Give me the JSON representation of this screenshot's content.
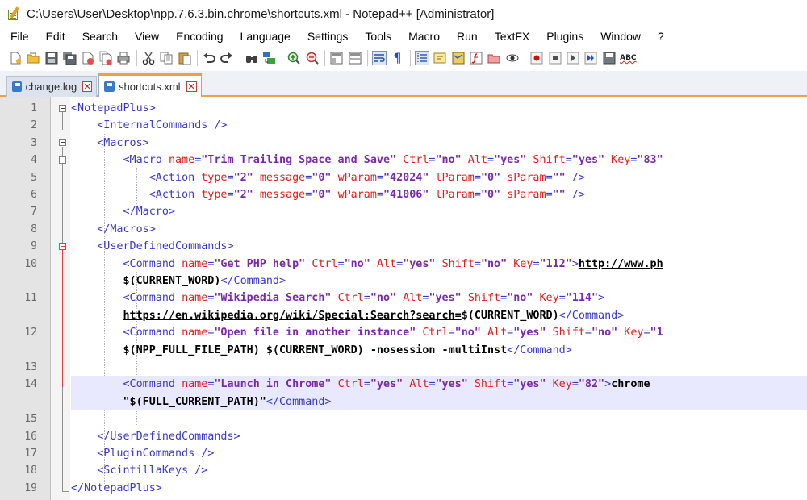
{
  "window": {
    "title": "C:\\Users\\User\\Desktop\\npp.7.6.3.bin.chrome\\shortcuts.xml - Notepad++ [Administrator]"
  },
  "menu": [
    "File",
    "Edit",
    "Search",
    "View",
    "Encoding",
    "Language",
    "Settings",
    "Tools",
    "Macro",
    "Run",
    "TextFX",
    "Plugins",
    "Window",
    "?"
  ],
  "toolbar": {
    "buttons": [
      "new-file-icon",
      "open-file-icon",
      "save-icon",
      "save-all-icon",
      "close-icon",
      "close-all-icon",
      "print-icon",
      "cut-icon",
      "copy-icon",
      "paste-icon",
      "undo-icon",
      "redo-icon",
      "find-icon",
      "replace-icon",
      "zoom-in-icon",
      "zoom-out-icon",
      "sync-vertical-icon",
      "sync-horizontal-icon",
      "word-wrap-icon",
      "show-all-chars-icon",
      "indent-guide-icon",
      "user-language-icon",
      "document-map-icon",
      "function-list-icon",
      "folder-workspace-icon",
      "monitoring-icon",
      "record-macro-icon",
      "stop-record-icon",
      "play-macro-icon",
      "run-macro-multiple-icon",
      "save-macro-icon",
      "spell-check-icon"
    ],
    "pilcrow": "¶",
    "spell_label": "ABC"
  },
  "tabs": [
    {
      "label": "change.log",
      "active": false
    },
    {
      "label": "shortcuts.xml",
      "active": true
    }
  ],
  "tab_close_glyph": "✕",
  "editor": {
    "line_numbers": [
      "1",
      "2",
      "3",
      "4",
      "5",
      "6",
      "7",
      "8",
      "9",
      "10",
      "",
      "11",
      "",
      "12",
      "",
      "13",
      "14",
      "",
      "15",
      "16",
      "17",
      "18",
      "19"
    ],
    "colors": {
      "tag": "#3a3ac8",
      "attr": "#e02020",
      "value": "#7a2aa8",
      "highlight": "#e8e8ff"
    }
  },
  "code": {
    "l1": "<NotepadPlus>",
    "l2": "<InternalCommands />",
    "l3": "<Macros>",
    "l4": {
      "open": "<Macro ",
      "a1": "name",
      "v1": "\"Trim Trailing Space and Save\"",
      "a2": "Ctrl",
      "v2": "\"no\"",
      "a3": "Alt",
      "v3": "\"yes\"",
      "a4": "Shift",
      "v4": "\"yes\"",
      "a5": "Key",
      "v5": "\"83\""
    },
    "l5": {
      "open": "<Action ",
      "a1": "type",
      "v1": "\"2\"",
      "a2": "message",
      "v2": "\"0\"",
      "a3": "wParam",
      "v3": "\"42024\"",
      "a4": "lParam",
      "v4": "\"0\"",
      "a5": "sParam",
      "v5": "\"\"",
      "close": "/>"
    },
    "l6": {
      "open": "<Action ",
      "a1": "type",
      "v1": "\"2\"",
      "a2": "message",
      "v2": "\"0\"",
      "a3": "wParam",
      "v3": "\"41006\"",
      "a4": "lParam",
      "v4": "\"0\"",
      "a5": "sParam",
      "v5": "\"\"",
      "close": "/>"
    },
    "l7": "</Macro>",
    "l8": "</Macros>",
    "l9": "<UserDefinedCommands>",
    "l10": {
      "open": "<Command ",
      "a1": "name",
      "v1": "\"Get PHP help\"",
      "a2": "Ctrl",
      "v2": "\"no\"",
      "a3": "Alt",
      "v3": "\"yes\"",
      "a4": "Shift",
      "v4": "\"no\"",
      "a5": "Key",
      "v5": "\"112\"",
      "gt": ">",
      "url": "http://www.ph"
    },
    "l10b": {
      "text": "$(CURRENT_WORD)",
      "close": "</Command>"
    },
    "l11": {
      "open": "<Command ",
      "a1": "name",
      "v1": "\"Wikipedia Search\"",
      "a2": "Ctrl",
      "v2": "\"no\"",
      "a3": "Alt",
      "v3": "\"yes\"",
      "a4": "Shift",
      "v4": "\"no\"",
      "a5": "Key",
      "v5": "\"114\"",
      "gt": ">"
    },
    "l11b": {
      "url": "https://en.wikipedia.org/wiki/Special:Search?search=",
      "text": "$(CURRENT_WORD)",
      "close": "</Command>"
    },
    "l12": {
      "open": "<Command ",
      "a1": "name",
      "v1": "\"Open file in another instance\"",
      "a2": "Ctrl",
      "v2": "\"no\"",
      "a3": "Alt",
      "v3": "\"yes\"",
      "a4": "Shift",
      "v4": "\"no\"",
      "a5": "Key",
      "v5": "\"1"
    },
    "l12b": {
      "text": "$(NPP_FULL_FILE_PATH) $(CURRENT_WORD) -nosession -multiInst",
      "close": "</Command>"
    },
    "l14": {
      "open": "<Command ",
      "a1": "name",
      "v1": "\"Launch in Chrome\"",
      "a2": "Ctrl",
      "v2": "\"yes\"",
      "a3": "Alt",
      "v3": "\"yes\"",
      "a4": "Shift",
      "v4": "\"yes\"",
      "a5": "Key",
      "v5": "\"82\"",
      "gt": ">",
      "text": "chrome"
    },
    "l14b": {
      "text": "\"$(FULL_CURRENT_PATH)\"",
      "close": "</Command>"
    },
    "l16": "</UserDefinedCommands>",
    "l17": "<PluginCommands />",
    "l18": "<ScintillaKeys />",
    "l19": "</NotepadPlus>"
  }
}
